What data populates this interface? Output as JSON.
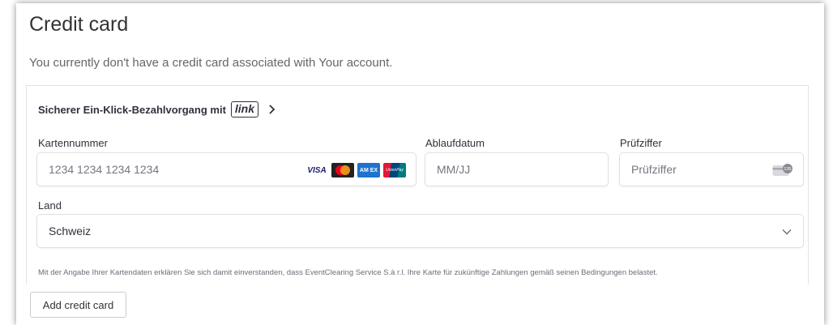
{
  "page": {
    "title": "Credit card",
    "subtitle": "You currently don't have a credit card associated with Your account."
  },
  "form": {
    "link_text": "Sicherer Ein-Klick-Bezahlvorgang mit",
    "link_logo": "link",
    "card_number": {
      "label": "Kartennummer",
      "placeholder": "1234 1234 1234 1234"
    },
    "expiry": {
      "label": "Ablaufdatum",
      "placeholder": "MM/JJ"
    },
    "cvc": {
      "label": "Prüfziffer",
      "placeholder": "Prüfziffer",
      "icon_text": "135"
    },
    "country": {
      "label": "Land",
      "value": "Schweiz"
    },
    "terms": "Mit der Angabe Ihrer Kartendaten erklären Sie sich damit einverstanden, dass EventClearing Service S.à r.l. Ihre Karte für zukünftige Zahlungen gemäß seinen Bedingungen belastet.",
    "brands": {
      "visa": "VISA",
      "amex": "AM EX",
      "unionpay": "UnionPay"
    }
  },
  "actions": {
    "add_label": "Add credit card"
  },
  "colors": {
    "text_dark": "#30313d",
    "placeholder": "#757680",
    "visa_blue": "#1a1f71",
    "mc_red": "#eb001b",
    "mc_yellow": "#f79e1b",
    "amex_blue": "#1f72cd",
    "unionpay_red": "#e21836"
  }
}
